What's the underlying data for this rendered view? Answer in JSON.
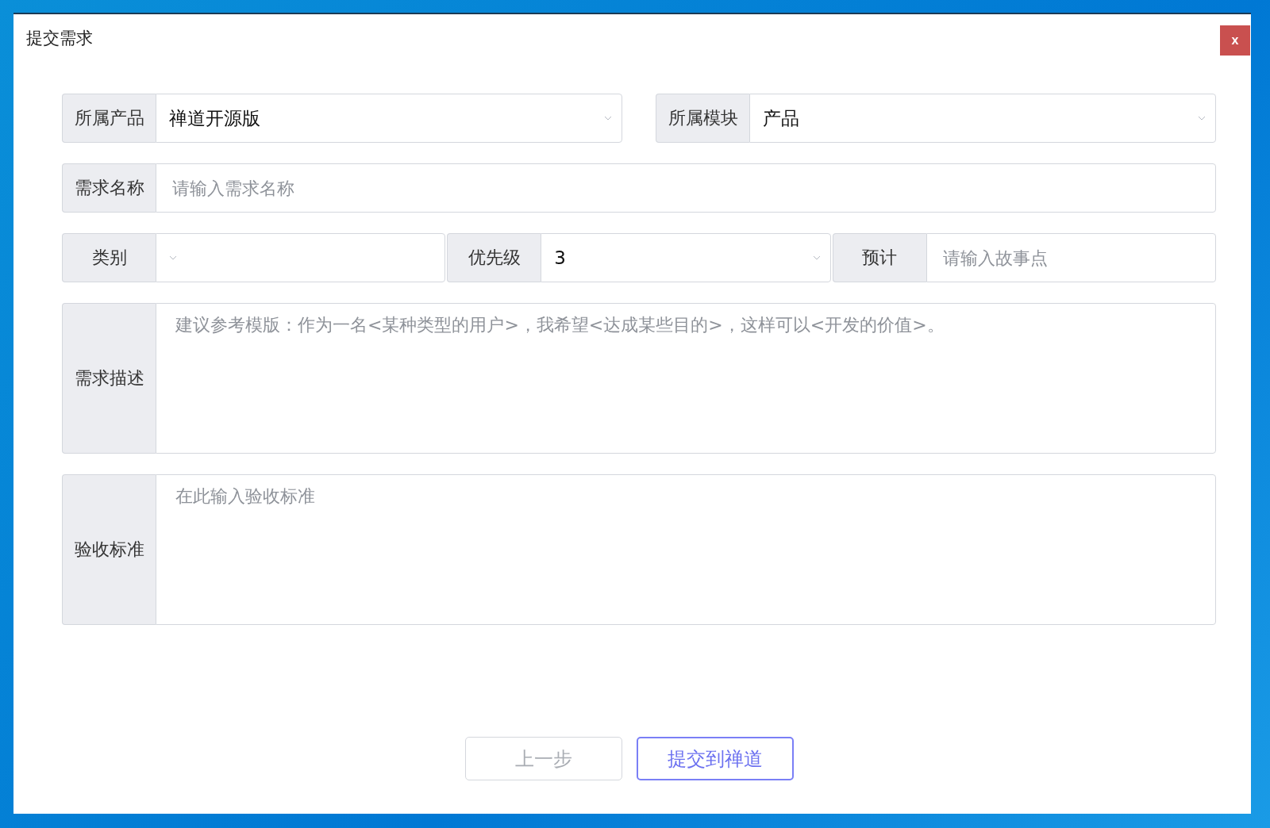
{
  "dialog": {
    "title": "提交需求",
    "close": "x"
  },
  "form_rows": [
    {
      "fields": [
        {
          "kind": "select",
          "label": "所属产品",
          "value": "禅道开源版"
        },
        {
          "kind": "select",
          "label": "所属模块",
          "value": "产品"
        }
      ]
    },
    {
      "fields": [
        {
          "kind": "input",
          "label": "需求名称",
          "placeholder": "请输入需求名称"
        }
      ]
    },
    {
      "fields": [
        {
          "kind": "select",
          "label": "类别"
        },
        {
          "kind": "select",
          "label": "优先级",
          "value": "3"
        },
        {
          "kind": "input",
          "label": "预计",
          "placeholder": "请输入故事点"
        }
      ]
    },
    {
      "fields": [
        {
          "kind": "textarea",
          "label": "需求描述",
          "placeholder": "建议参考模版：作为一名<某种类型的用户>，我希望<达成某些目的>，这样可以<开发的价值>。"
        }
      ]
    },
    {
      "fields": [
        {
          "kind": "textarea",
          "label": "验收标准",
          "placeholder": "在此输入验收标准"
        }
      ]
    }
  ],
  "buttons": [
    {
      "label": "上一步",
      "disabled": true
    },
    {
      "label": "提交到禅道",
      "disabled": false
    }
  ]
}
